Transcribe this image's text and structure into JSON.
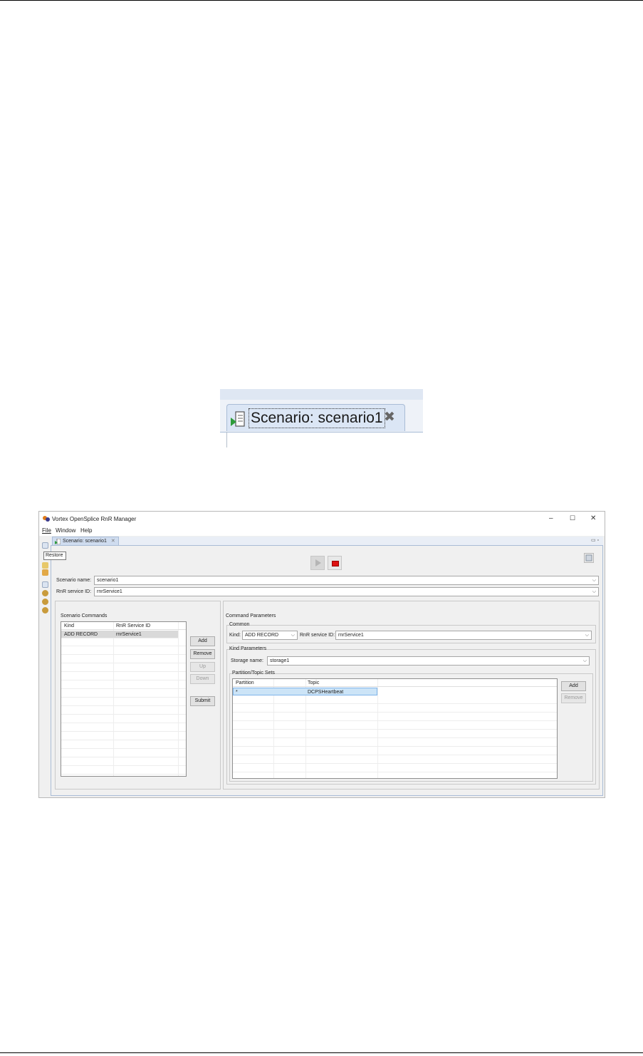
{
  "zoomed_tab": {
    "label": "Scenario: scenario1"
  },
  "window": {
    "title": "Vortex OpenSplice RnR Manager",
    "controls": {
      "minimize": "–",
      "maximize": "☐",
      "close": "✕"
    },
    "menu": [
      "File",
      "Window",
      "Help"
    ],
    "tooltip": "Restore",
    "editor_tab": "Scenario: scenario1",
    "scenario_name_label": "Scenario name:",
    "scenario_name": "scenario1",
    "rnr_service_label": "RnR service ID:",
    "rnr_service": "rnrService1",
    "scenario_commands": {
      "title": "Scenario Commands",
      "columns": [
        "Kind",
        "RnR Service ID"
      ],
      "rows": [
        {
          "kind": "ADD RECORD",
          "service": "rnrService1"
        }
      ],
      "buttons": {
        "add": "Add",
        "remove": "Remove",
        "up": "Up",
        "down": "Down",
        "submit": "Submit"
      }
    },
    "command_parameters": {
      "title": "Command Parameters",
      "common_title": "Common",
      "kind_label": "Kind:",
      "kind_value": "ADD RECORD",
      "service_label": "RnR service ID:",
      "service_value": "rnrService1",
      "kind_params_title": "Kind Parameters",
      "storage_label": "Storage name:",
      "storage_value": "storage1",
      "sets_title": "Partition/Topic Sets",
      "columns": [
        "Partition",
        "Topic"
      ],
      "rows": [
        {
          "partition": "*",
          "topic": "DCPSHeartbeat"
        }
      ],
      "buttons": {
        "add": "Add",
        "remove": "Remove"
      }
    }
  }
}
